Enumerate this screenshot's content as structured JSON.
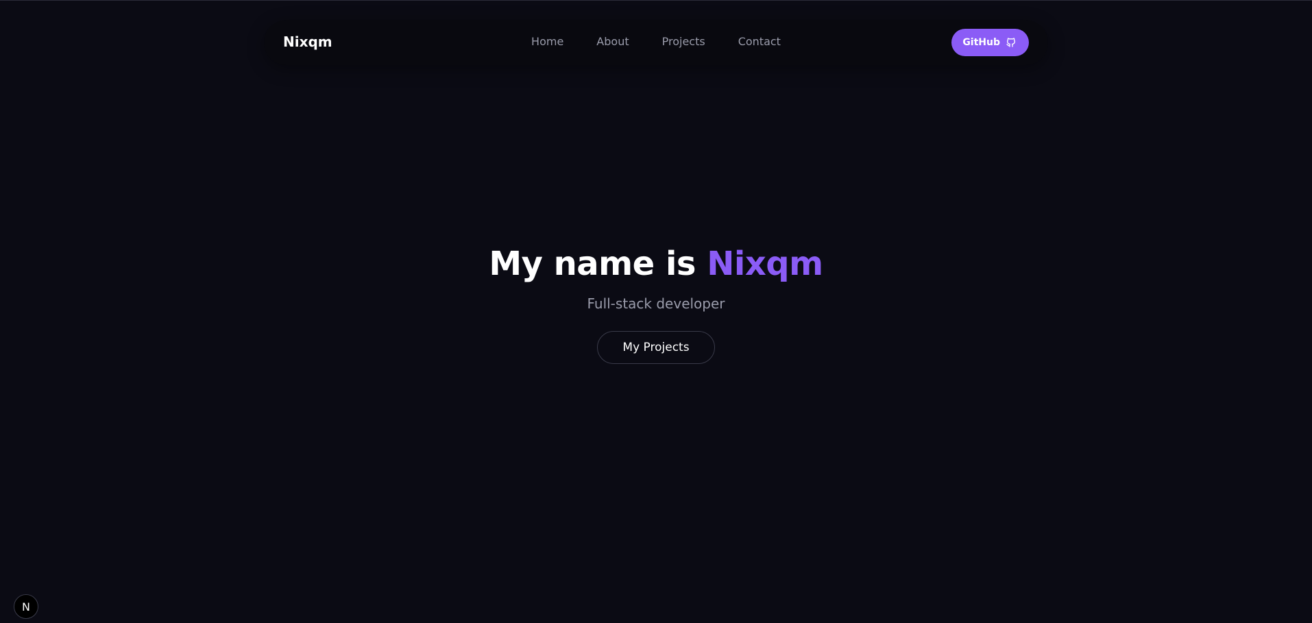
{
  "navbar": {
    "logo": "Nixqm",
    "links": [
      {
        "label": "Home"
      },
      {
        "label": "About"
      },
      {
        "label": "Projects"
      },
      {
        "label": "Contact"
      }
    ],
    "github_button": {
      "label": "GitHub",
      "icon": "github-icon"
    }
  },
  "hero": {
    "title_prefix": "My name is",
    "title_name": "Nixqm",
    "subtitle": "Full-stack developer",
    "cta_label": "My Projects"
  },
  "dev_badge": {
    "label": "N",
    "icon": "nextjs-icon"
  },
  "colors": {
    "background": "#0b0b14",
    "navbar_bg": "#09090f",
    "accent": "#8b5cf6",
    "muted_text": "#9a9cab",
    "text": "#ffffff"
  }
}
